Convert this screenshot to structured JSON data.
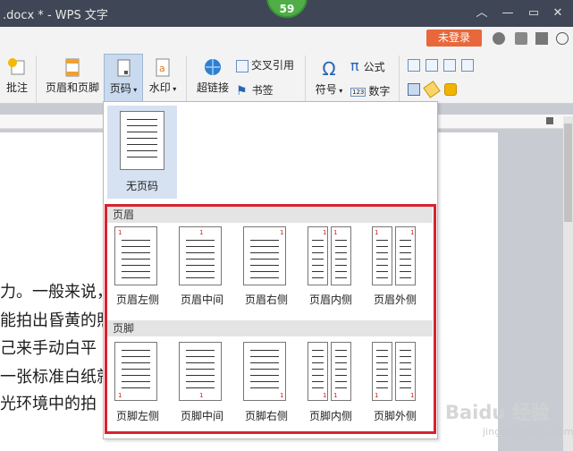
{
  "window": {
    "title": ".docx * - WPS 文字",
    "badge_count": "59"
  },
  "ribbon": {
    "comment_label": "批注",
    "header_footer_label": "页眉和页脚",
    "page_number_label": "页码",
    "watermark_label": "水印",
    "hyperlink_label": "超链接",
    "cross_ref_label": "交叉引用",
    "bookmark_label": "书签",
    "symbol_label": "符号",
    "formula_label": "公式",
    "number_label": "数字",
    "login_label": "未登录"
  },
  "document": {
    "lines": [
      "力。一般来说，",
      "能拍出昏黄的照",
      "己来手动白平",
      "一张标准白纸就",
      "光环境中的拍"
    ]
  },
  "dropdown": {
    "no_page_number_label": "无页码",
    "header_section_label": "页眉",
    "footer_section_label": "页脚",
    "header_items": [
      "页眉左侧",
      "页眉中间",
      "页眉右侧",
      "页眉内侧",
      "页眉外侧"
    ],
    "footer_items": [
      "页脚左侧",
      "页脚中间",
      "页脚右侧",
      "页脚内侧",
      "页脚外侧"
    ],
    "page_num_mark": "1"
  },
  "watermark": {
    "brand": "Baidu 经验",
    "url": "jingyan.baidu.com"
  },
  "colors": {
    "titlebar": "#3f4756",
    "login_button": "#e8683b",
    "highlight_frame": "#d8232f",
    "badge": "#4fae47",
    "selected_item": "#d6e2f2"
  }
}
